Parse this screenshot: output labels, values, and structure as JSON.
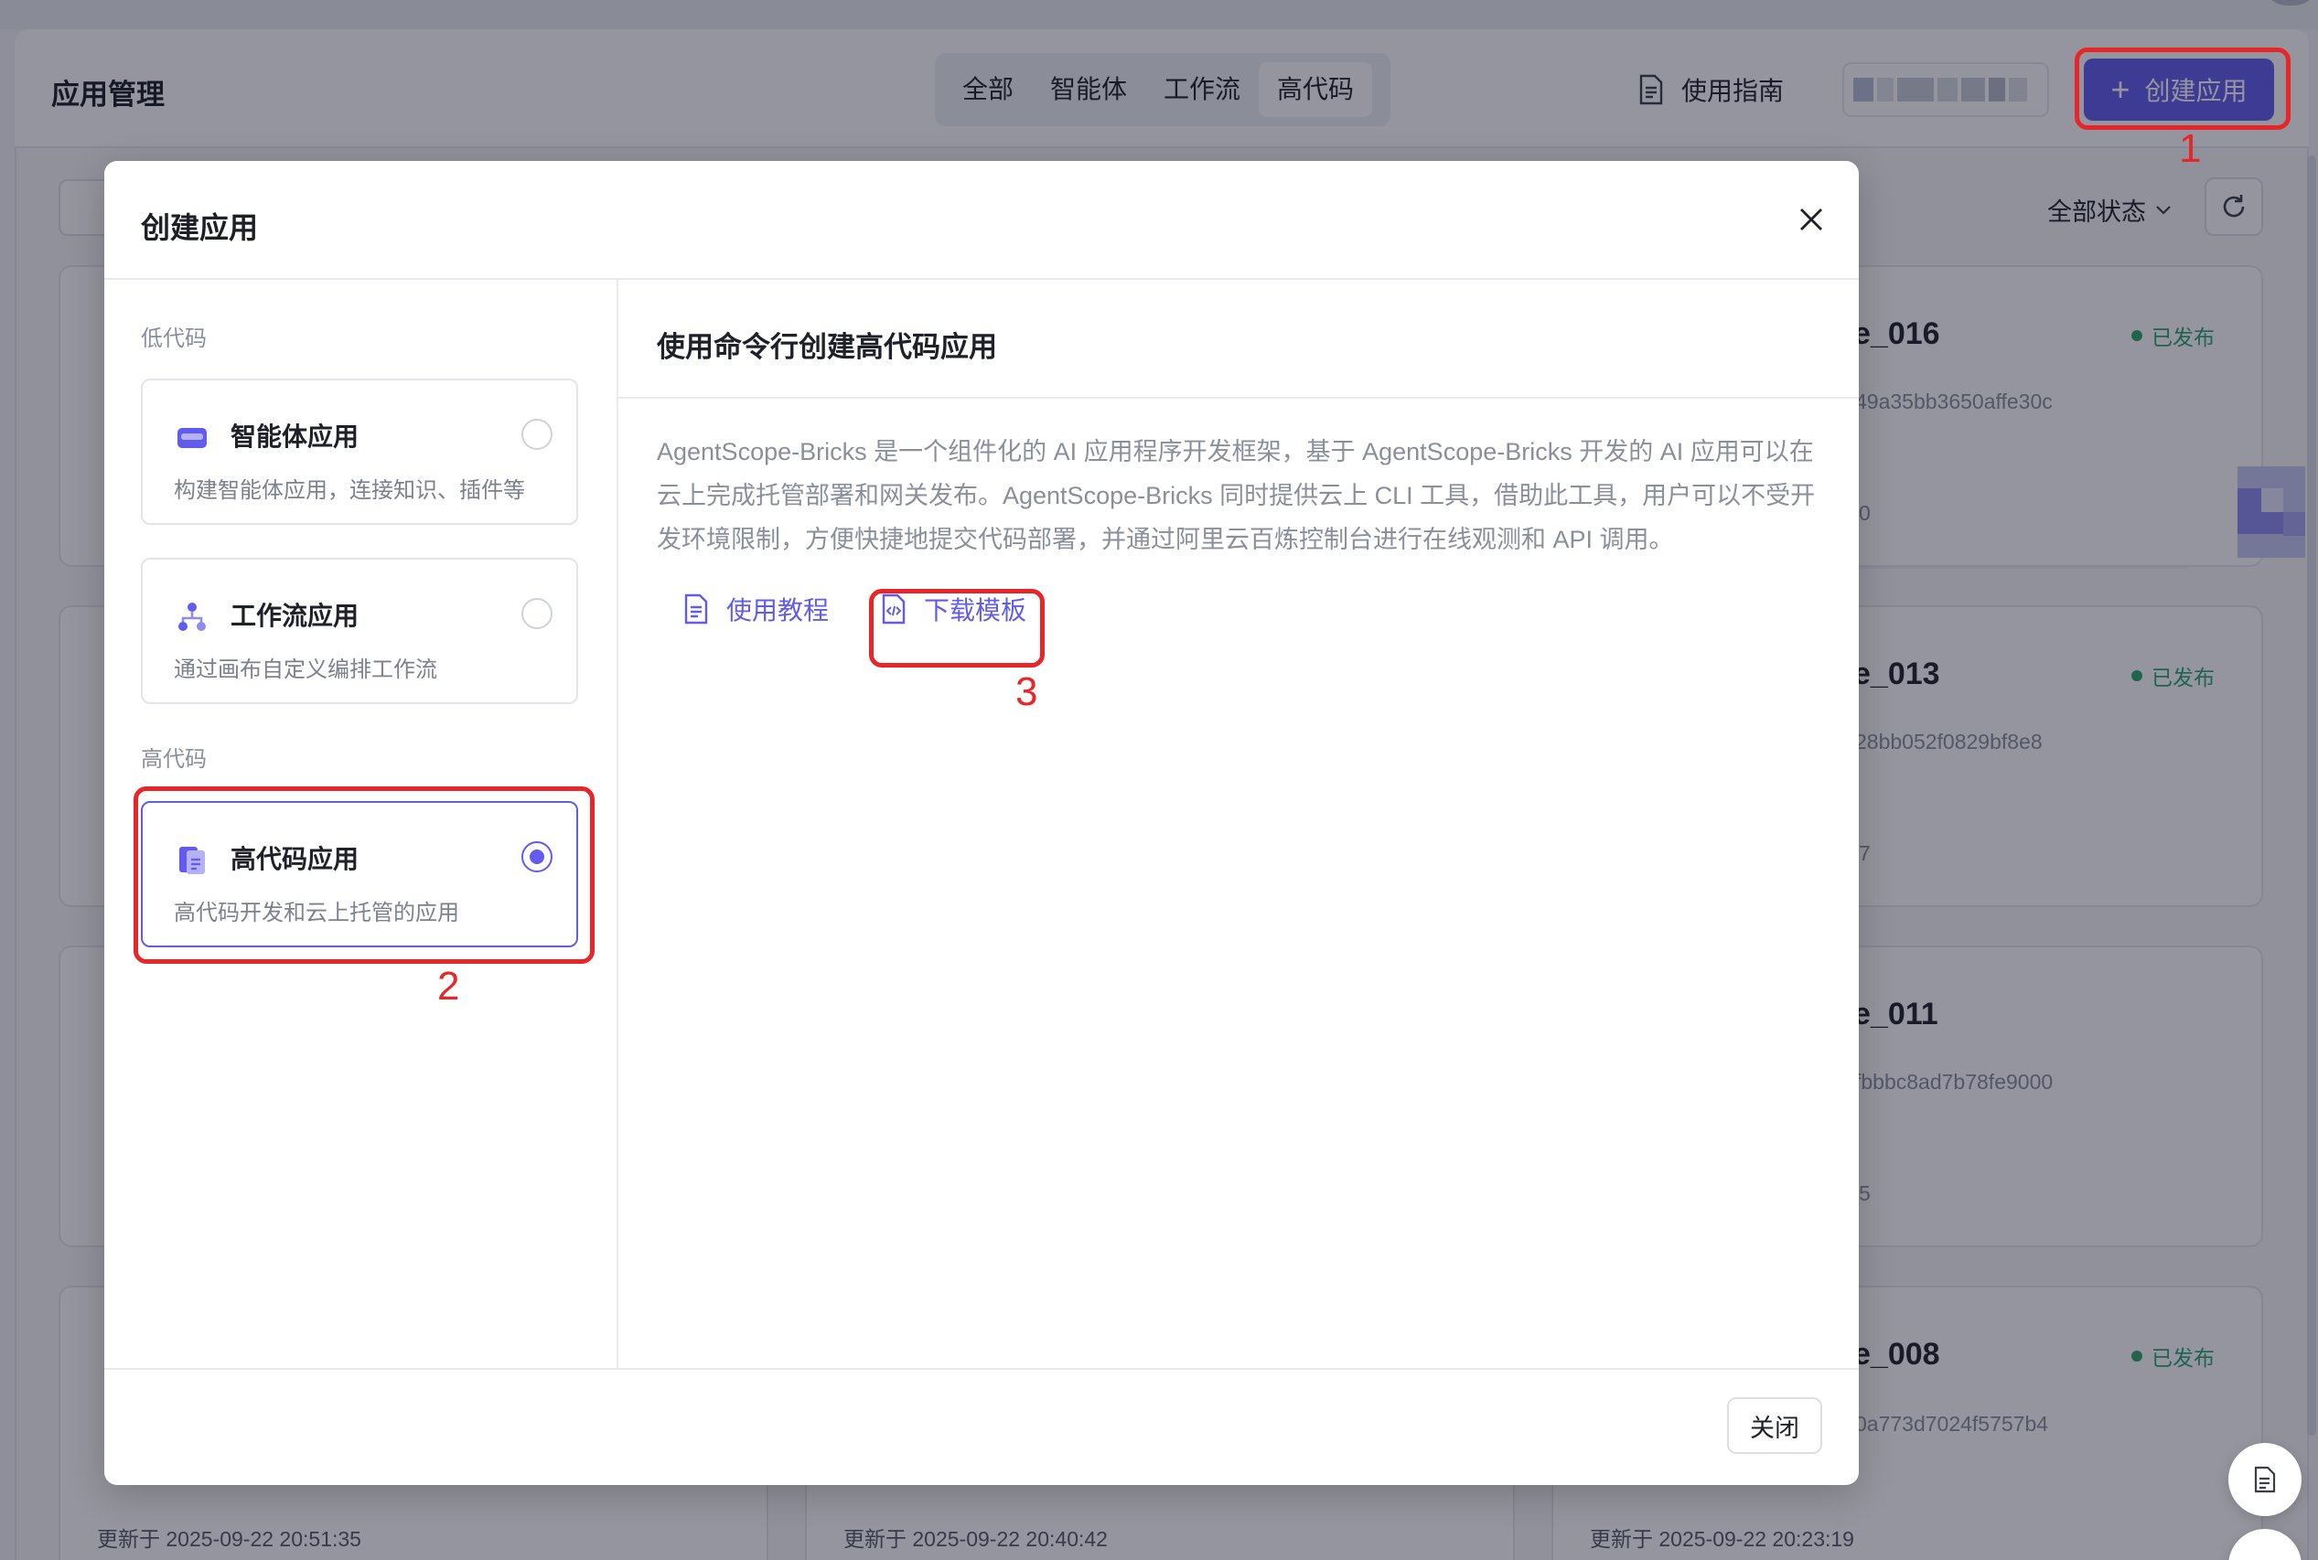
{
  "app": {
    "title": "应用管理",
    "filter_tabs": [
      "全部",
      "智能体",
      "工作流",
      "高代码"
    ],
    "active_filter_index": 3,
    "guide_label": "使用指南",
    "create_button_label": "创建应用",
    "status_filter_label": "全部状态"
  },
  "cards": [
    {
      "name": "e_016",
      "id": "49a35bb3650affe30c",
      "stat": "0",
      "status": "已发布"
    },
    {
      "name": "e_013",
      "id": "28bb052f0829bf8e8",
      "stat": "7",
      "status": "已发布"
    },
    {
      "name": "e_011",
      "id": "fbbbc8ad7b78fe9000",
      "stat": "5"
    },
    {
      "name": "e_008",
      "id": "0a773d7024f5757b4",
      "status": "已发布"
    }
  ],
  "bottom_updates": [
    "更新于 2025-09-22 20:51:35",
    "更新于 2025-09-22 20:40:42",
    "更新于 2025-09-22 20:23:19"
  ],
  "modal": {
    "title": "创建应用",
    "group_low_code": "低代码",
    "group_high_code": "高代码",
    "options": [
      {
        "name": "智能体应用",
        "desc": "构建智能体应用，连接知识、插件等",
        "icon": "agent-box-icon",
        "selected": false
      },
      {
        "name": "工作流应用",
        "desc": "通过画布自定义编排工作流",
        "icon": "workflow-nodes-icon",
        "selected": false
      },
      {
        "name": "高代码应用",
        "desc": "高代码开发和云上托管的应用",
        "icon": "code-file-icon",
        "selected": true
      }
    ],
    "right_title": "使用命令行创建高代码应用",
    "description": "AgentScope-Bricks 是一个组件化的 AI 应用程序开发框架，基于 AgentScope-Bricks 开发的 AI 应用可以在云上完成托管部署和网关发布。AgentScope-Bricks 同时提供云上 CLI 工具，借助此工具，用户可以不受开发环境限制，方便快捷地提交代码部署，并通过阿里云百炼控制台进行在线观测和 API 调用。",
    "link_tutorial": "使用教程",
    "link_download": "下载模板",
    "close_button": "关闭"
  },
  "annotations": [
    "1",
    "2",
    "3"
  ],
  "colors": {
    "accent": "#615ced",
    "annotation": "#e8262a",
    "status_green": "#2ba471"
  }
}
